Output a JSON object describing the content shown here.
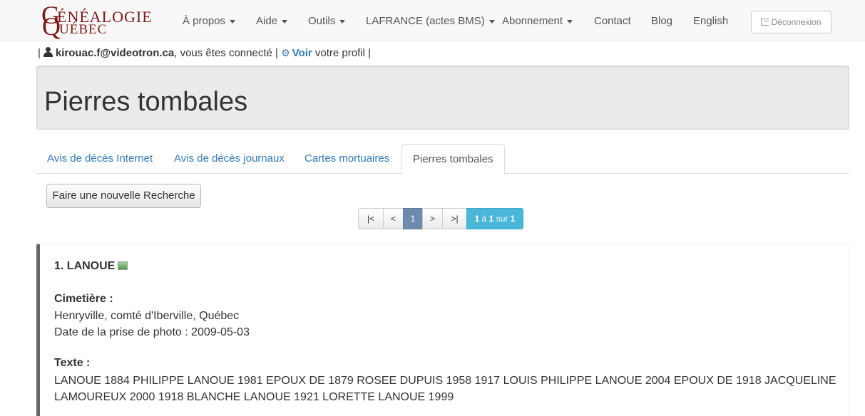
{
  "logo": {
    "letter1": "G",
    "text1": "ÉNÉALOGIE",
    "letter2": "Q",
    "text2": "UÉBEC"
  },
  "nav": {
    "items": [
      {
        "label": "À propos"
      },
      {
        "label": "Aide"
      },
      {
        "label": "Outils"
      },
      {
        "label": "LAFRANCE (actes BMS)"
      },
      {
        "label": "Abonnement"
      },
      {
        "label": "Contact"
      },
      {
        "label": "Blog"
      },
      {
        "label": "English"
      }
    ],
    "logout_label": "Déconnexion"
  },
  "user": {
    "sep1": "|",
    "email": "kirouac.f@videotron.ca",
    "connected": ", vous êtes connecté",
    "sep2": "|",
    "profile_link": "Voir",
    "profile_text": "votre profil",
    "sep3": "|"
  },
  "page_title": "Pierres tombales",
  "tabs": [
    {
      "label": "Avis de décès Internet"
    },
    {
      "label": "Avis de décès journaux"
    },
    {
      "label": "Cartes mortuaires"
    },
    {
      "label": "Pierres tombales"
    }
  ],
  "new_search_label": "Faire une nouvelle Recherche",
  "pagination": {
    "first": "|<",
    "prev": "<",
    "current": "1",
    "next": ">",
    "last": ">|",
    "info_from": "1",
    "info_a": "à",
    "info_to": "1",
    "info_sur": "sur",
    "info_total": "1"
  },
  "result": {
    "title": "1. LANOUE",
    "cemetery_label": "Cimetière :",
    "cemetery_value": "Henryville, comté d'Iberville, Québec",
    "photo_date": "Date de la prise de photo : 2009-05-03",
    "text_label": "Texte :",
    "text_value": "LANOUE 1884 PHILIPPE LANOUE 1981 EPOUX DE 1879 ROSEE DUPUIS 1958 1917 LOUIS PHILIPPE LANOUE 2004 EPOUX DE 1918 JACQUELINE LAMOUREUX 2000 1918 BLANCHE LANOUE 1921 LORETTE LANOUE 1999"
  }
}
